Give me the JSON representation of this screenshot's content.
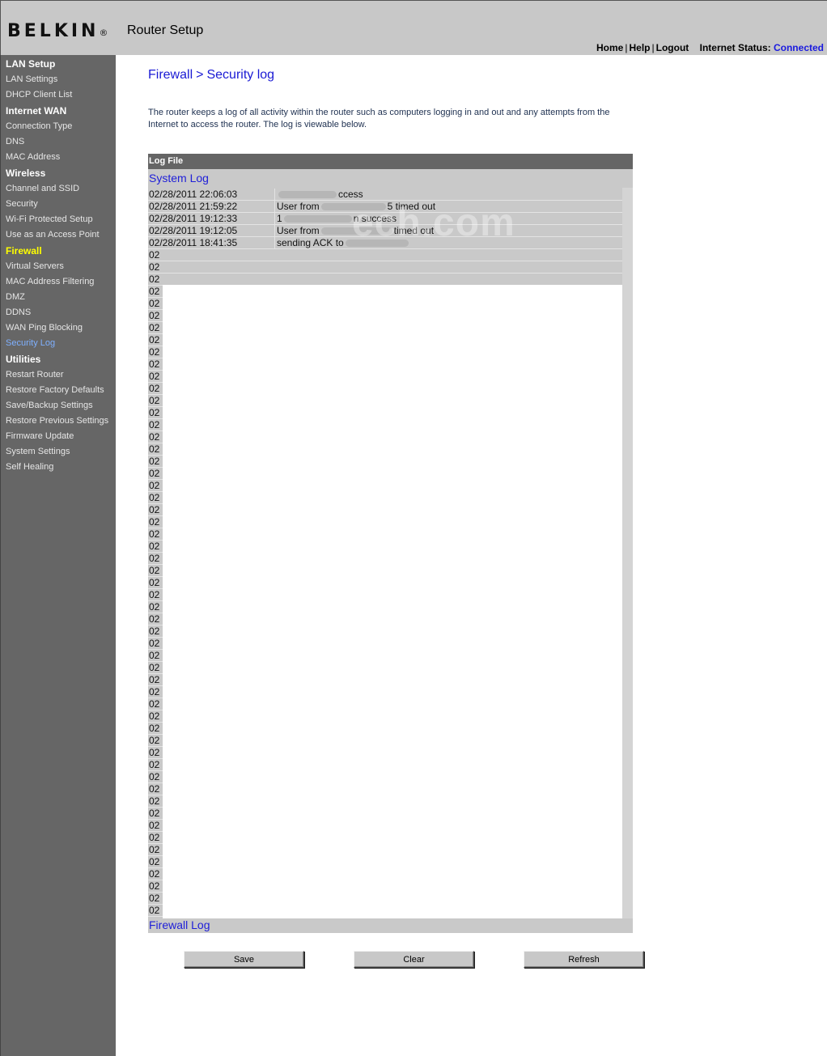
{
  "header": {
    "logo": "BELKIN",
    "logo_mark": "®",
    "title": "Router Setup",
    "nav": {
      "home": "Home",
      "help": "Help",
      "logout": "Logout",
      "status_label": "Internet Status:",
      "status_value": "Connected"
    },
    "colors": {
      "header_bg": "#c8c8c8",
      "status_value": "#1a1adf"
    }
  },
  "sidebar": {
    "sections": [
      {
        "title": "LAN Setup",
        "items": [
          "LAN Settings",
          "DHCP Client List"
        ]
      },
      {
        "title": "Internet WAN",
        "items": [
          "Connection Type",
          "DNS",
          "MAC Address"
        ]
      },
      {
        "title": "Wireless",
        "items": [
          "Channel and SSID",
          "Security",
          "Wi-Fi Protected Setup",
          "Use as an Access Point"
        ]
      },
      {
        "title": "Firewall",
        "active": true,
        "items": [
          "Virtual Servers",
          "MAC Address Filtering",
          "DMZ",
          "DDNS",
          "WAN Ping Blocking",
          "Security Log"
        ],
        "active_item": "Security Log"
      },
      {
        "title": "Utilities",
        "items": [
          "Restart Router",
          "Restore Factory Defaults",
          "Save/Backup Settings",
          "Restore Previous Settings",
          "Firmware Update",
          "System Settings",
          "Self Healing"
        ]
      }
    ],
    "colors": {
      "bg": "#666666",
      "active_section": "#ffff00",
      "active_item": "#7fb0ff"
    }
  },
  "main": {
    "breadcrumb_section": "Firewall",
    "breadcrumb_sep": ">",
    "breadcrumb_page": "Security log",
    "intro": "The router keeps a log of all activity within the router such as computers logging in and out and any attempts from the Internet to access the router. The log is viewable below.",
    "panel_header": "Log File",
    "system_log_label": "System Log",
    "firewall_log_label": "Firewall Log",
    "log_entries": [
      {
        "time": "02/28/2011 22:06:03",
        "message_parts": [
          "",
          "ccess"
        ]
      },
      {
        "time": "02/28/2011 21:59:22",
        "message_parts": [
          "User from",
          "5 timed out"
        ]
      },
      {
        "time": "02/28/2011 19:12:33",
        "message_parts": [
          "1",
          "n success"
        ]
      },
      {
        "time": "02/28/2011 19:12:05",
        "message_parts": [
          "User from",
          "timed out"
        ]
      },
      {
        "time": "02/28/2011 18:41:35",
        "message_parts": [
          "sending ACK to",
          ""
        ]
      }
    ],
    "truncated_entry_prefix": "02",
    "truncated_entry_count": 55,
    "buttons": {
      "save": "Save",
      "clear": "Clear",
      "refresh": "Refresh"
    },
    "watermark": "ech.com",
    "colors": {
      "title": "#1a1ad4",
      "panel_header_bg": "#656565",
      "panel_bg": "#c9c9c9"
    }
  }
}
